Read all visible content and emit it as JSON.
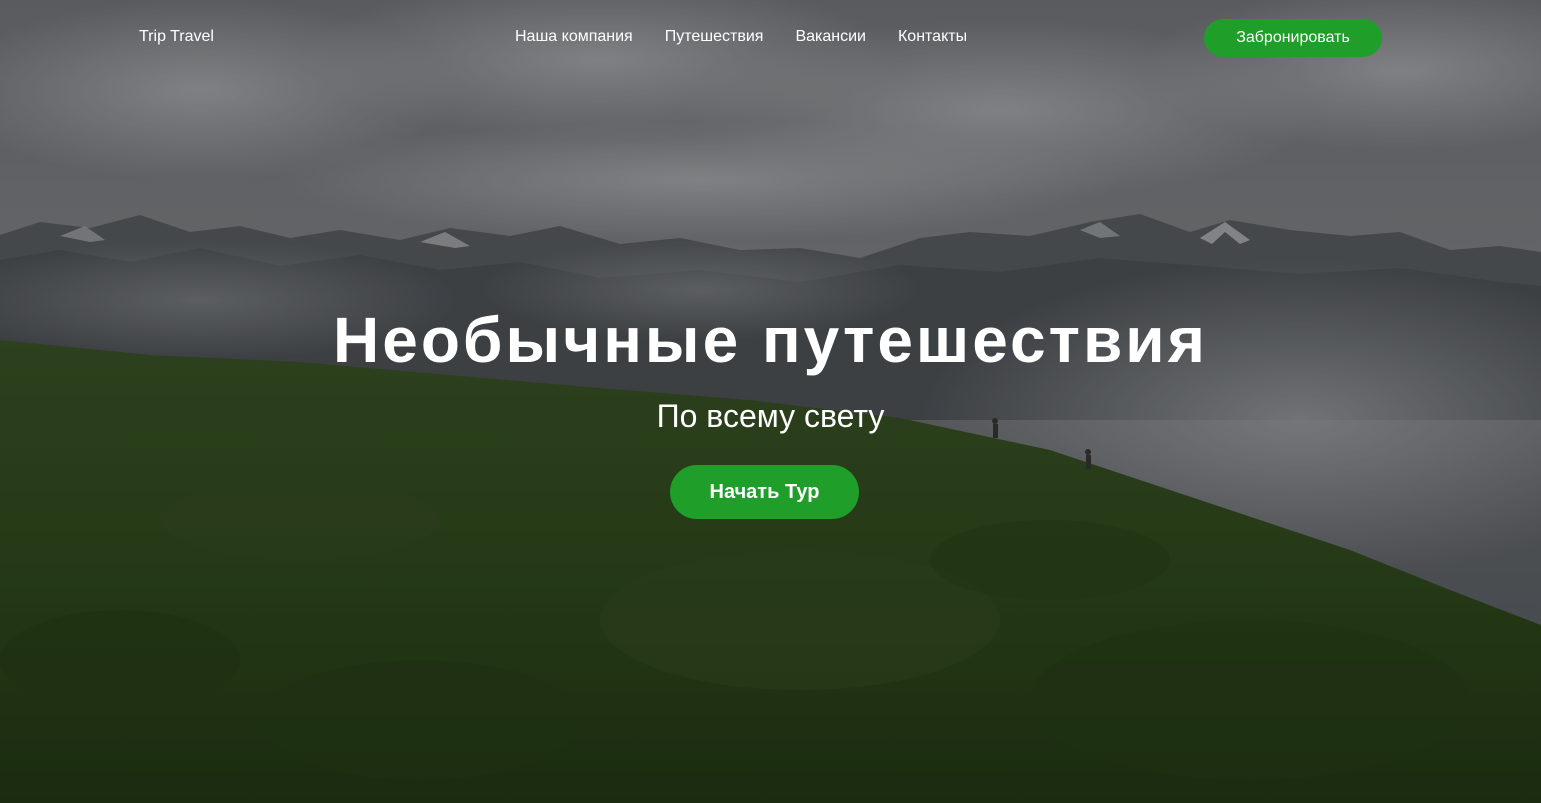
{
  "header": {
    "logo": "Trip Travel",
    "nav": [
      {
        "label": "Наша компания"
      },
      {
        "label": "Путешествия"
      },
      {
        "label": "Вакансии"
      },
      {
        "label": "Контакты"
      }
    ],
    "book_label": "Забронировать"
  },
  "hero": {
    "title": "Необычные путешествия",
    "subtitle": "По всему свету",
    "cta_label": "Начать Тур",
    "background_icon": "mountain-landscape-photo"
  },
  "colors": {
    "accent": "#1f9e2a",
    "text": "#ffffff"
  }
}
